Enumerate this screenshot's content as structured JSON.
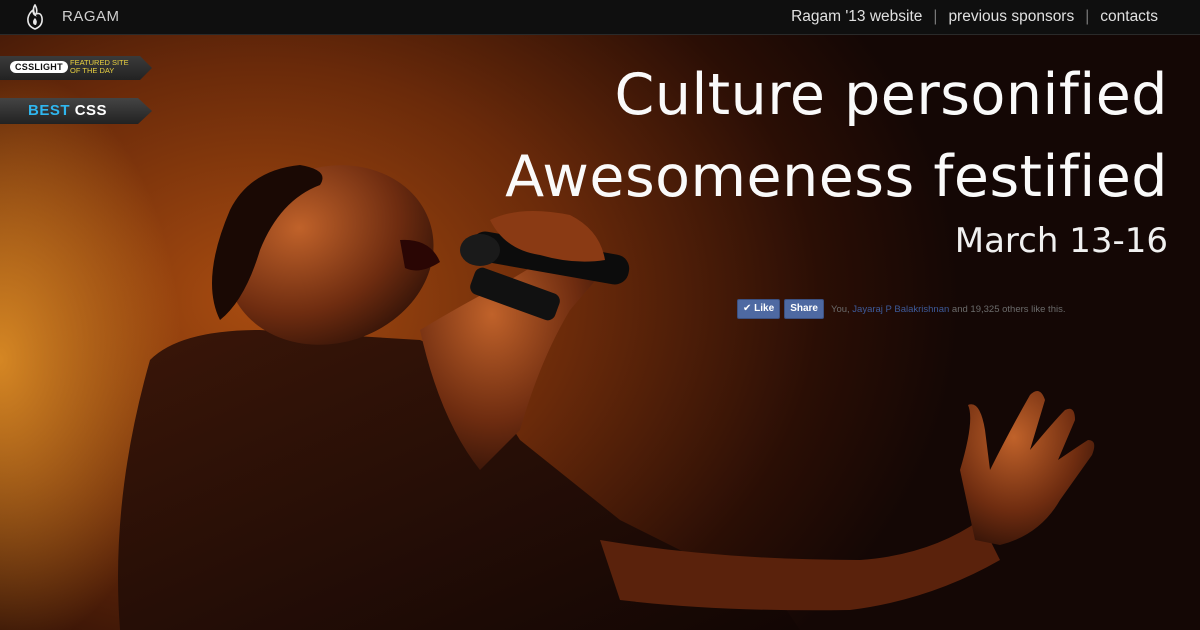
{
  "header": {
    "brand": "RAGAM",
    "logo_icon": "flame-logo-icon",
    "nav": [
      {
        "label": "Ragam '13 website"
      },
      {
        "label": "previous sponsors"
      },
      {
        "label": "contacts"
      }
    ],
    "separator": "|"
  },
  "badges": {
    "csslight": {
      "tag": "CSSLIGHT",
      "line1": "FEATURED SITE",
      "line2": "OF THE DAY"
    },
    "bestcss": {
      "best": "BEST",
      "css": "CSS"
    }
  },
  "hero": {
    "line1": "Culture personified",
    "line2": "Awesomeness festified",
    "date": "March 13-16"
  },
  "facebook": {
    "like_label": "Like",
    "share_label": "Share",
    "text_you": "You, ",
    "text_name": "Jayaraj P Balakrishnan",
    "text_rest": " and 19,325 others like this."
  },
  "colors": {
    "topbar": "#0f0f0f",
    "best_accent": "#2fb6ee",
    "facebook_blue": "#4e69a2"
  }
}
